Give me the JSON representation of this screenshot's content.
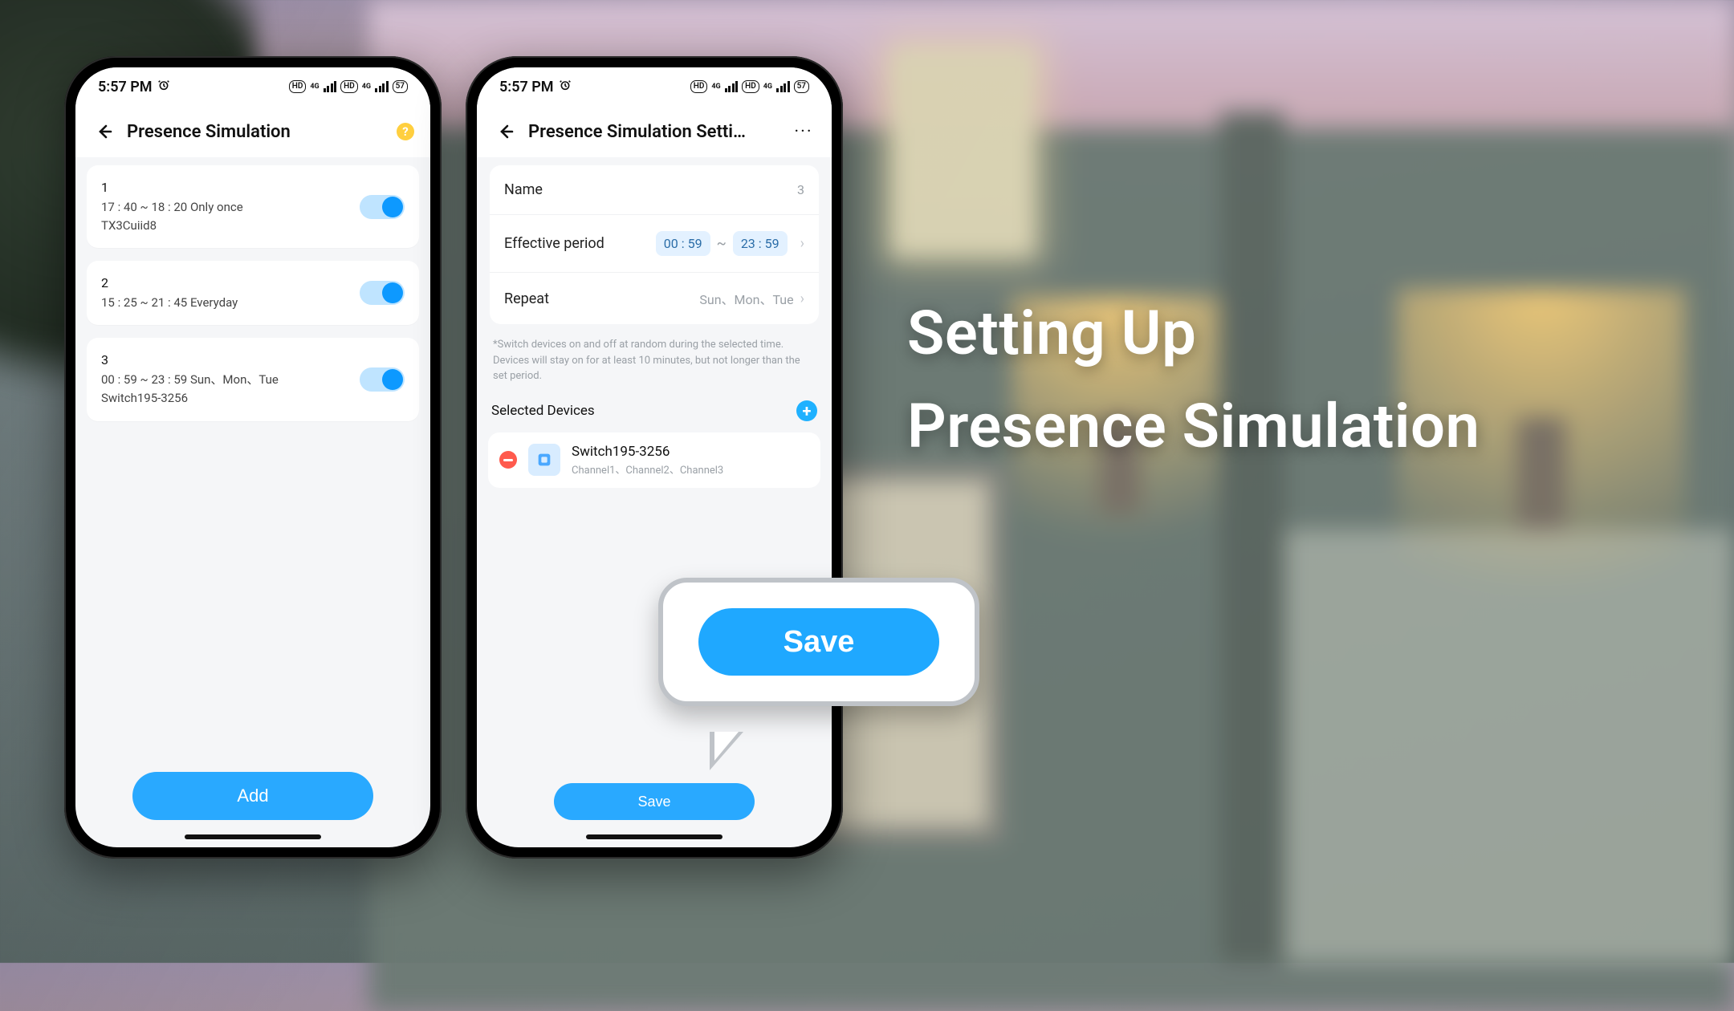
{
  "headline": {
    "line1": "Setting Up",
    "line2": "Presence Simulation"
  },
  "status": {
    "time": "5:57 PM",
    "alarm_icon": "alarm-icon",
    "hd_label": "HD",
    "net_label": "4G",
    "battery_label": "57"
  },
  "phone_left": {
    "title": "Presence Simulation",
    "help": "?",
    "items": [
      {
        "index": "1",
        "time": "17 : 40 ~ 18 : 20 Only once",
        "device": "TX3Cuiid8",
        "on": true
      },
      {
        "index": "2",
        "time": "15 : 25 ~ 21 : 45 Everyday",
        "device": "",
        "on": true
      },
      {
        "index": "3",
        "time": "00 : 59 ~ 23 : 59 Sun、Mon、Tue",
        "device": "Switch195-3256",
        "on": true
      }
    ],
    "add_label": "Add"
  },
  "phone_right": {
    "title": "Presence Simulation Setti…",
    "rows": {
      "name_label": "Name",
      "name_value": "3",
      "period_label": "Effective period",
      "period_from": "00 : 59",
      "period_to": "23 : 59",
      "repeat_label": "Repeat",
      "repeat_value": "Sun、Mon、Tue"
    },
    "note": "*Switch devices on and off at random during the selected time. Devices will stay on for at least 10 minutes, but not longer than the set period.",
    "selected_label": "Selected Devices",
    "device": {
      "name": "Switch195-3256",
      "sub": "Channel1、Channel2、Channel3"
    },
    "save_label": "Save"
  },
  "callout": {
    "save_label": "Save"
  }
}
